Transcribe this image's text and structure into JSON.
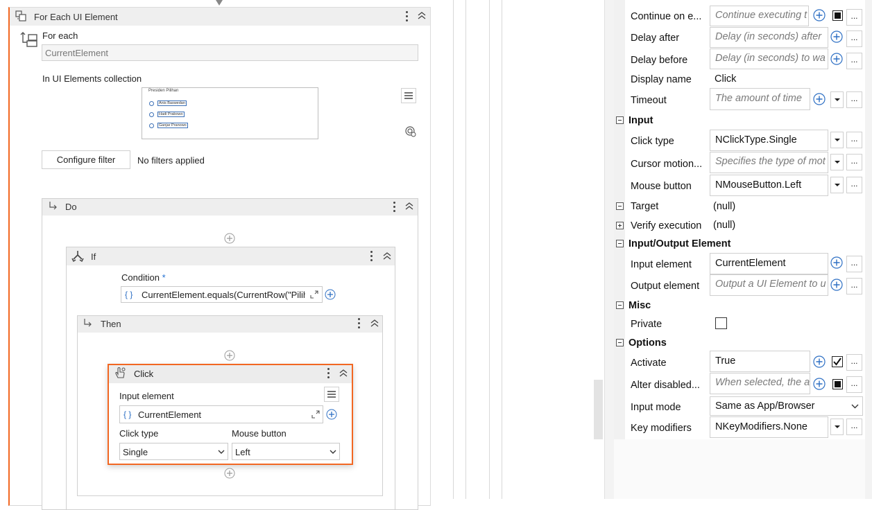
{
  "designer": {
    "for_each": {
      "title": "For Each UI Element",
      "for_each_label": "For each",
      "item_name": "CurrentElement",
      "collection_label": "In UI Elements collection",
      "preview": {
        "heading": "Presiden Pilihan",
        "options": [
          "Anis Baswedan",
          "Hadi Prabowo",
          "Ganjar Pranowo"
        ]
      },
      "configure_filter_button": "Configure filter",
      "filter_status": "No filters applied"
    },
    "do": {
      "title": "Do"
    },
    "if": {
      "title": "If",
      "condition_label": "Condition",
      "required_marker": "*",
      "condition_expr": "CurrentElement.equals(CurrentRow(\"Piliha"
    },
    "then": {
      "title": "Then"
    },
    "click": {
      "title": "Click",
      "input_element_label": "Input element",
      "input_element_value": "CurrentElement",
      "click_type_label": "Click type",
      "click_type_value": "Single",
      "mouse_button_label": "Mouse button",
      "mouse_button_value": "Left"
    },
    "expr_glyph": "{ }",
    "accent_color": "#f26722"
  },
  "properties": {
    "rows": {
      "continue_on_error": {
        "label": "Continue on e...",
        "placeholder": "Continue executing t"
      },
      "delay_after": {
        "label": "Delay after",
        "placeholder": "Delay (in seconds) after"
      },
      "delay_before": {
        "label": "Delay before",
        "placeholder": "Delay (in seconds) to wa"
      },
      "display_name": {
        "label": "Display name",
        "value": "Click"
      },
      "timeout": {
        "label": "Timeout",
        "placeholder": "The amount of time"
      },
      "click_type": {
        "label": "Click type",
        "value": "NClickType.Single"
      },
      "cursor_motion": {
        "label": "Cursor motion...",
        "placeholder": "Specifies the type of mot"
      },
      "mouse_button": {
        "label": "Mouse button",
        "value": "NMouseButton.Left"
      },
      "target": {
        "label": "Target",
        "value": "(null)"
      },
      "verify_execution": {
        "label": "Verify execution",
        "value": "(null)"
      },
      "input_element": {
        "label": "Input element",
        "value": "CurrentElement"
      },
      "output_element": {
        "label": "Output element",
        "placeholder": "Output a UI Element to u"
      },
      "private": {
        "label": "Private",
        "checked": false
      },
      "activate": {
        "label": "Activate",
        "value": "True",
        "checked": true
      },
      "alter_disabled": {
        "label": "Alter disabled...",
        "placeholder": "When selected, the a"
      },
      "input_mode": {
        "label": "Input mode",
        "value": "Same as App/Browser"
      },
      "key_modifiers": {
        "label": "Key modifiers",
        "value": "NKeyModifiers.None"
      }
    },
    "sections": {
      "input": "Input",
      "input_output": "Input/Output Element",
      "misc": "Misc",
      "options": "Options"
    },
    "dots_label": "..."
  }
}
